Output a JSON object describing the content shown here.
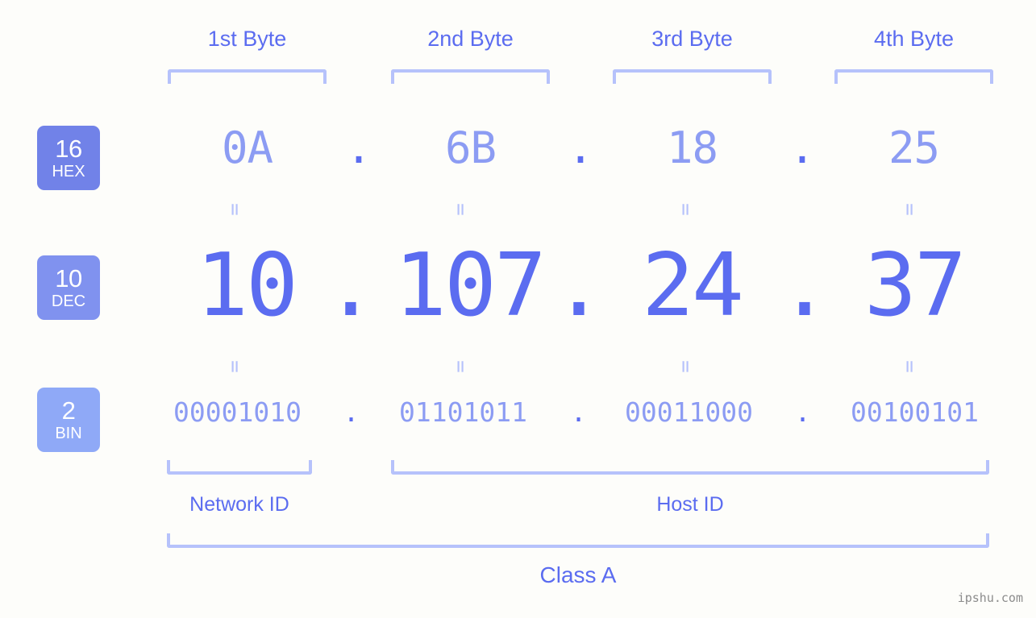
{
  "theme": {
    "background": "#fdfdfa",
    "accent_strong": "#5b6cf0",
    "accent_light": "#8c9cf3",
    "bracket": "#b6c2fb",
    "watermark_color": "#8c8c8c"
  },
  "byte_headers": [
    {
      "label": "1st Byte"
    },
    {
      "label": "2nd Byte"
    },
    {
      "label": "3rd Byte"
    },
    {
      "label": "4th Byte"
    }
  ],
  "rows": [
    {
      "base": "16",
      "base_name": "HEX",
      "badge_color": "#7182e8",
      "values": [
        "0A",
        "6B",
        "18",
        "25"
      ],
      "separator": "."
    },
    {
      "base": "10",
      "base_name": "DEC",
      "badge_color": "#8092ef",
      "values": [
        "10",
        "107",
        "24",
        "37"
      ],
      "separator": "."
    },
    {
      "base": "2",
      "base_name": "BIN",
      "badge_color": "#8fa9f7",
      "values": [
        "00001010",
        "01101011",
        "00011000",
        "00100101"
      ],
      "separator": "."
    }
  ],
  "equivalence_symbol": "=",
  "segments": {
    "network_id": "Network ID",
    "host_id": "Host ID"
  },
  "class_label": "Class A",
  "watermark": "ipshu.com"
}
